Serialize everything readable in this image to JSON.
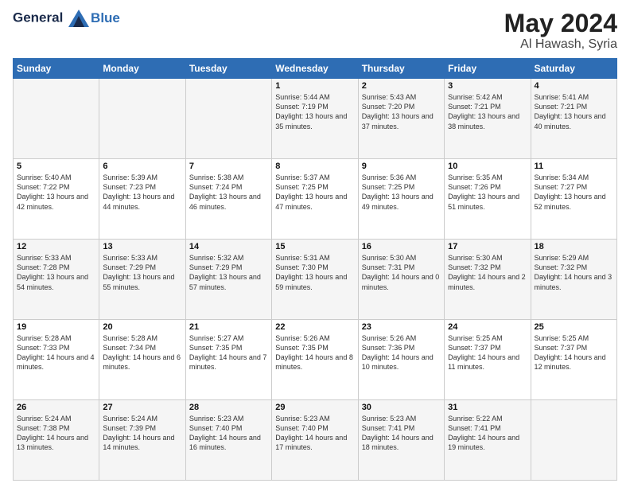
{
  "header": {
    "logo_line1": "General",
    "logo_line2": "Blue",
    "month_title": "May 2024",
    "location": "Al Hawash, Syria"
  },
  "days_of_week": [
    "Sunday",
    "Monday",
    "Tuesday",
    "Wednesday",
    "Thursday",
    "Friday",
    "Saturday"
  ],
  "weeks": [
    [
      {
        "day": "",
        "sunrise": "",
        "sunset": "",
        "daylight": ""
      },
      {
        "day": "",
        "sunrise": "",
        "sunset": "",
        "daylight": ""
      },
      {
        "day": "",
        "sunrise": "",
        "sunset": "",
        "daylight": ""
      },
      {
        "day": "1",
        "sunrise": "Sunrise: 5:44 AM",
        "sunset": "Sunset: 7:19 PM",
        "daylight": "Daylight: 13 hours and 35 minutes."
      },
      {
        "day": "2",
        "sunrise": "Sunrise: 5:43 AM",
        "sunset": "Sunset: 7:20 PM",
        "daylight": "Daylight: 13 hours and 37 minutes."
      },
      {
        "day": "3",
        "sunrise": "Sunrise: 5:42 AM",
        "sunset": "Sunset: 7:21 PM",
        "daylight": "Daylight: 13 hours and 38 minutes."
      },
      {
        "day": "4",
        "sunrise": "Sunrise: 5:41 AM",
        "sunset": "Sunset: 7:21 PM",
        "daylight": "Daylight: 13 hours and 40 minutes."
      }
    ],
    [
      {
        "day": "5",
        "sunrise": "Sunrise: 5:40 AM",
        "sunset": "Sunset: 7:22 PM",
        "daylight": "Daylight: 13 hours and 42 minutes."
      },
      {
        "day": "6",
        "sunrise": "Sunrise: 5:39 AM",
        "sunset": "Sunset: 7:23 PM",
        "daylight": "Daylight: 13 hours and 44 minutes."
      },
      {
        "day": "7",
        "sunrise": "Sunrise: 5:38 AM",
        "sunset": "Sunset: 7:24 PM",
        "daylight": "Daylight: 13 hours and 46 minutes."
      },
      {
        "day": "8",
        "sunrise": "Sunrise: 5:37 AM",
        "sunset": "Sunset: 7:25 PM",
        "daylight": "Daylight: 13 hours and 47 minutes."
      },
      {
        "day": "9",
        "sunrise": "Sunrise: 5:36 AM",
        "sunset": "Sunset: 7:25 PM",
        "daylight": "Daylight: 13 hours and 49 minutes."
      },
      {
        "day": "10",
        "sunrise": "Sunrise: 5:35 AM",
        "sunset": "Sunset: 7:26 PM",
        "daylight": "Daylight: 13 hours and 51 minutes."
      },
      {
        "day": "11",
        "sunrise": "Sunrise: 5:34 AM",
        "sunset": "Sunset: 7:27 PM",
        "daylight": "Daylight: 13 hours and 52 minutes."
      }
    ],
    [
      {
        "day": "12",
        "sunrise": "Sunrise: 5:33 AM",
        "sunset": "Sunset: 7:28 PM",
        "daylight": "Daylight: 13 hours and 54 minutes."
      },
      {
        "day": "13",
        "sunrise": "Sunrise: 5:33 AM",
        "sunset": "Sunset: 7:29 PM",
        "daylight": "Daylight: 13 hours and 55 minutes."
      },
      {
        "day": "14",
        "sunrise": "Sunrise: 5:32 AM",
        "sunset": "Sunset: 7:29 PM",
        "daylight": "Daylight: 13 hours and 57 minutes."
      },
      {
        "day": "15",
        "sunrise": "Sunrise: 5:31 AM",
        "sunset": "Sunset: 7:30 PM",
        "daylight": "Daylight: 13 hours and 59 minutes."
      },
      {
        "day": "16",
        "sunrise": "Sunrise: 5:30 AM",
        "sunset": "Sunset: 7:31 PM",
        "daylight": "Daylight: 14 hours and 0 minutes."
      },
      {
        "day": "17",
        "sunrise": "Sunrise: 5:30 AM",
        "sunset": "Sunset: 7:32 PM",
        "daylight": "Daylight: 14 hours and 2 minutes."
      },
      {
        "day": "18",
        "sunrise": "Sunrise: 5:29 AM",
        "sunset": "Sunset: 7:32 PM",
        "daylight": "Daylight: 14 hours and 3 minutes."
      }
    ],
    [
      {
        "day": "19",
        "sunrise": "Sunrise: 5:28 AM",
        "sunset": "Sunset: 7:33 PM",
        "daylight": "Daylight: 14 hours and 4 minutes."
      },
      {
        "day": "20",
        "sunrise": "Sunrise: 5:28 AM",
        "sunset": "Sunset: 7:34 PM",
        "daylight": "Daylight: 14 hours and 6 minutes."
      },
      {
        "day": "21",
        "sunrise": "Sunrise: 5:27 AM",
        "sunset": "Sunset: 7:35 PM",
        "daylight": "Daylight: 14 hours and 7 minutes."
      },
      {
        "day": "22",
        "sunrise": "Sunrise: 5:26 AM",
        "sunset": "Sunset: 7:35 PM",
        "daylight": "Daylight: 14 hours and 8 minutes."
      },
      {
        "day": "23",
        "sunrise": "Sunrise: 5:26 AM",
        "sunset": "Sunset: 7:36 PM",
        "daylight": "Daylight: 14 hours and 10 minutes."
      },
      {
        "day": "24",
        "sunrise": "Sunrise: 5:25 AM",
        "sunset": "Sunset: 7:37 PM",
        "daylight": "Daylight: 14 hours and 11 minutes."
      },
      {
        "day": "25",
        "sunrise": "Sunrise: 5:25 AM",
        "sunset": "Sunset: 7:37 PM",
        "daylight": "Daylight: 14 hours and 12 minutes."
      }
    ],
    [
      {
        "day": "26",
        "sunrise": "Sunrise: 5:24 AM",
        "sunset": "Sunset: 7:38 PM",
        "daylight": "Daylight: 14 hours and 13 minutes."
      },
      {
        "day": "27",
        "sunrise": "Sunrise: 5:24 AM",
        "sunset": "Sunset: 7:39 PM",
        "daylight": "Daylight: 14 hours and 14 minutes."
      },
      {
        "day": "28",
        "sunrise": "Sunrise: 5:23 AM",
        "sunset": "Sunset: 7:40 PM",
        "daylight": "Daylight: 14 hours and 16 minutes."
      },
      {
        "day": "29",
        "sunrise": "Sunrise: 5:23 AM",
        "sunset": "Sunset: 7:40 PM",
        "daylight": "Daylight: 14 hours and 17 minutes."
      },
      {
        "day": "30",
        "sunrise": "Sunrise: 5:23 AM",
        "sunset": "Sunset: 7:41 PM",
        "daylight": "Daylight: 14 hours and 18 minutes."
      },
      {
        "day": "31",
        "sunrise": "Sunrise: 5:22 AM",
        "sunset": "Sunset: 7:41 PM",
        "daylight": "Daylight: 14 hours and 19 minutes."
      },
      {
        "day": "",
        "sunrise": "",
        "sunset": "",
        "daylight": ""
      }
    ]
  ]
}
